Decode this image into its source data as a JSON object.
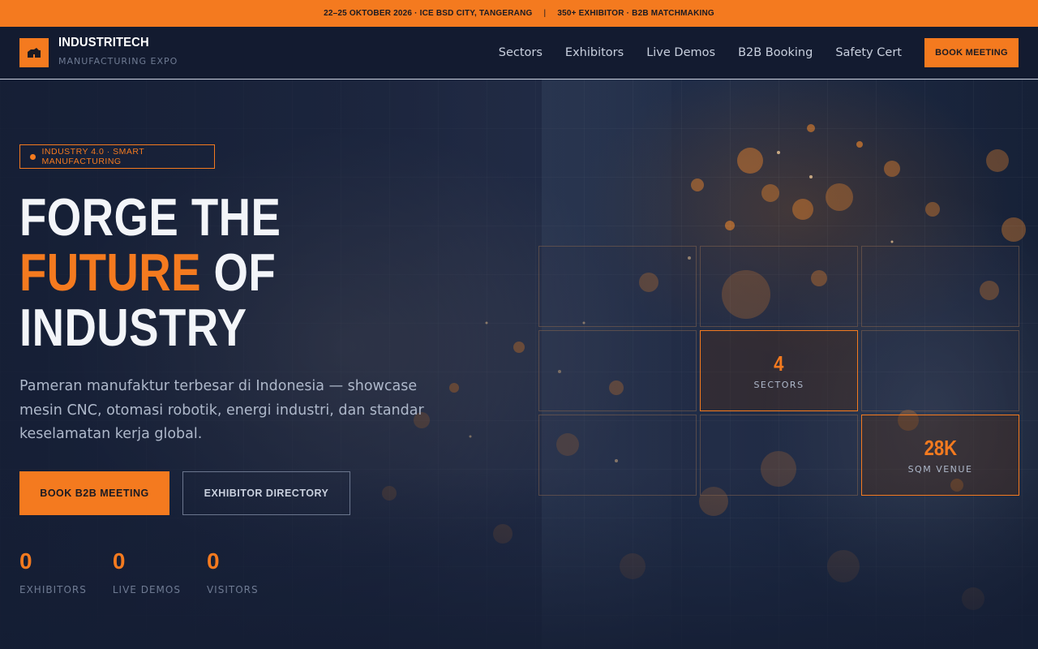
{
  "topbar": {
    "left": "22–25 OKTOBER 2026 · ICE BSD CITY, TANGERANG",
    "separator": "|",
    "right": "350+ EXHIBITOR · B2B MATCHMAKING"
  },
  "brand": {
    "name": "INDUSTRITECH",
    "subtitle": "MANUFACTURING EXPO",
    "logo_icon": "factory-icon",
    "accent": "#f47a1f"
  },
  "nav": {
    "links": [
      "Sectors",
      "Exhibitors",
      "Live Demos",
      "B2B Booking",
      "Safety Cert"
    ],
    "cta": "BOOK MEETING"
  },
  "hero": {
    "tag": "INDUSTRY 4.0 · SMART MANUFACTURING",
    "headline": {
      "line1": "FORGE THE",
      "line2_accent": "FUTURE",
      "line2_rest": " OF",
      "line3": "INDUSTRY"
    },
    "lead": "Pameran manufaktur terbesar di Indonesia — showcase mesin CNC, otomasi robotik, energi industri, dan standar keselamatan kerja global.",
    "primary_button": "BOOK B2B MEETING",
    "secondary_button": "EXHIBITOR DIRECTORY",
    "stats": [
      {
        "value": "0",
        "label": "EXHIBITORS"
      },
      {
        "value": "0",
        "label": "LIVE DEMOS"
      },
      {
        "value": "0",
        "label": "VISITORS"
      }
    ],
    "tiles": [
      {
        "value": "",
        "label": ""
      },
      {
        "value": "",
        "label": ""
      },
      {
        "value": "",
        "label": ""
      },
      {
        "value": "",
        "label": ""
      },
      {
        "value": "4",
        "label": "SECTORS"
      },
      {
        "value": "",
        "label": ""
      },
      {
        "value": "",
        "label": ""
      },
      {
        "value": "",
        "label": ""
      },
      {
        "value": "28K",
        "label": "SQM VENUE"
      }
    ]
  }
}
